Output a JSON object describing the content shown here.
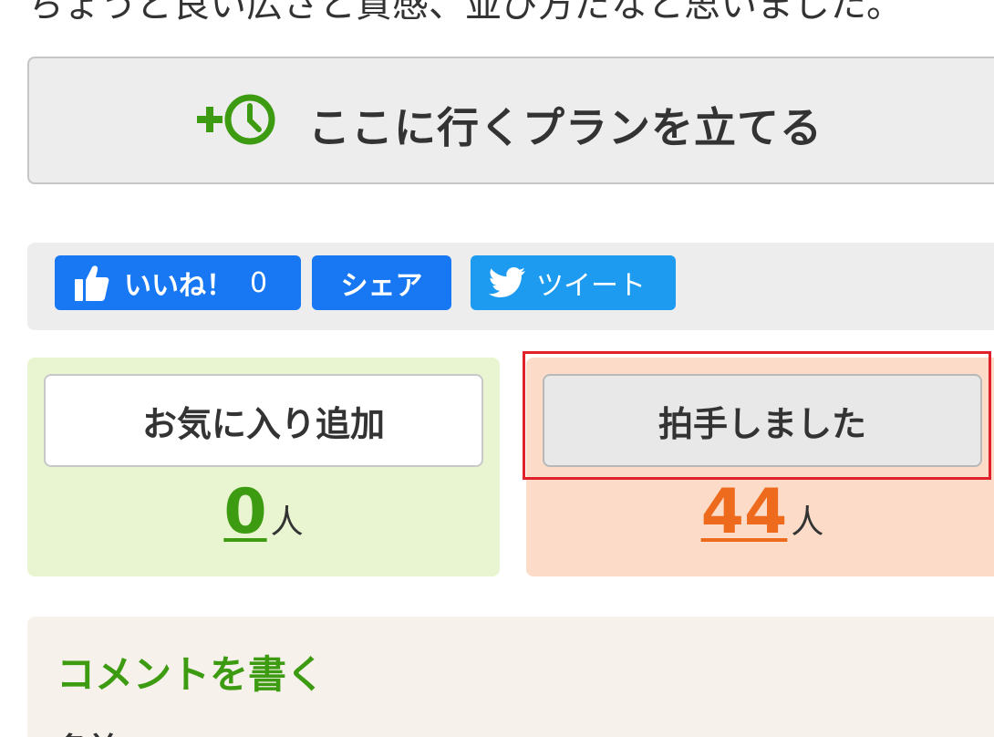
{
  "top_text": "ちょうど良い広さと質感、並び方だなと思いました。",
  "plan_button": {
    "label": "ここに行くプランを立てる",
    "icon": "add-clock-icon",
    "icon_color": "#3d9b12"
  },
  "social": {
    "like_label": "いいね！",
    "like_count": "0",
    "share_label": "シェア",
    "tweet_label": "ツイート",
    "facebook_color": "#1877f2",
    "twitter_color": "#1d9bf0"
  },
  "favorite": {
    "button_label": "お気に入り追加",
    "count": "0",
    "unit": "人",
    "count_color": "#3d9b12",
    "panel_color": "#e9f4d0"
  },
  "clap": {
    "button_label": "拍手しました",
    "count": "44",
    "unit": "人",
    "count_color": "#ee6a1c",
    "panel_color": "#fcdcc8"
  },
  "comment": {
    "title": "コメントを書く",
    "subtitle": "名前"
  },
  "highlight_color": "#e0202a"
}
